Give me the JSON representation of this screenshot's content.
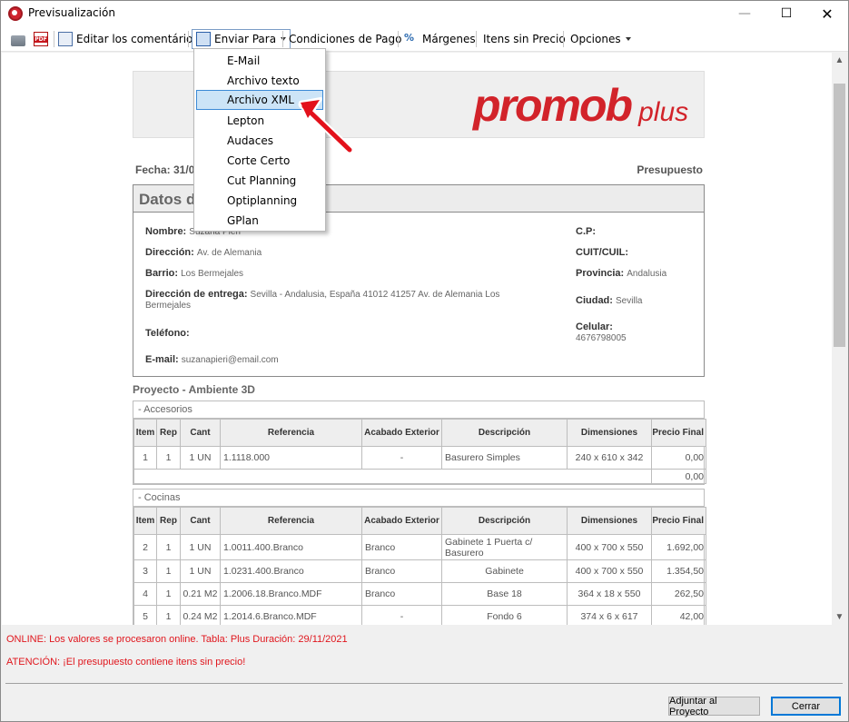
{
  "window": {
    "title": "Previsualización",
    "controls": {
      "minimize": "—",
      "maximize": "☐",
      "close": "✕"
    }
  },
  "toolbar": {
    "edit_comments": "Editar los comentários",
    "send_to": "Enviar Para",
    "payment_terms": "Condiciones de Pago",
    "margins": "Márgenes",
    "items_no_price": "Itens sin Precio",
    "options": "Opciones",
    "margins_icon_glyph": "%"
  },
  "send_menu": {
    "items": [
      "E-Mail",
      "Archivo texto",
      "Archivo XML",
      "Lepton",
      "Audaces",
      "Corte Certo",
      "Cut Planning",
      "Optiplanning",
      "GPlan"
    ],
    "highlighted": "Archivo XML"
  },
  "document": {
    "logo_main": "promob",
    "logo_sub": "plus",
    "date_label": "Fecha: 31/0",
    "doc_type": "Presupuesto",
    "client_section_title": "Datos de",
    "client": {
      "name_label": "Nombre:",
      "name_value": "Suzana Pieri",
      "address_label": "Dirección:",
      "address_value": "Av. de Alemania",
      "district_label": "Barrio:",
      "district_value": "Los Bermejales",
      "delivery_label": "Dirección de entrega:",
      "delivery_value": "Sevilla - Andalusia, España 41012 41257 Av. de Alemania Los Bermejales",
      "phone_label": "Teléfono:",
      "email_label": "E-mail:",
      "email_value": "suzanapieri@email.com",
      "zip_label": "C.P:",
      "tax_label": "CUIT/CUIL:",
      "province_label": "Provincia:",
      "province_value": "Andalusia",
      "city_label": "Ciudad:",
      "city_value": "Sevilla",
      "mobile_label": "Celular:",
      "mobile_value": "4676798005"
    },
    "project_title": "Proyecto - Ambiente 3D",
    "columns": [
      "Item",
      "Rep",
      "Cant",
      "Referencia",
      "Acabado Exterior",
      "Descripción",
      "Dimensiones",
      "Precio Final"
    ],
    "groups": [
      {
        "title": "- Accesorios",
        "rows": [
          [
            "1",
            "1",
            "1 UN",
            "1.1118.000",
            "-",
            "Basurero Simples",
            "240 x 610 x 342",
            "0,00"
          ]
        ],
        "subtotal": "0,00"
      },
      {
        "title": "- Cocinas",
        "rows": [
          [
            "2",
            "1",
            "1 UN",
            "1.0011.400.Branco",
            "Branco",
            "Gabinete 1 Puerta c/ Basurero",
            "400 x 700 x 550",
            "1.692,00"
          ],
          [
            "3",
            "1",
            "1 UN",
            "1.0231.400.Branco",
            "Branco",
            "Gabinete",
            "400 x 700 x 550",
            "1.354,50"
          ],
          [
            "4",
            "1",
            "0.21 M2",
            "1.2006.18.Branco.MDF",
            "Branco",
            "Base 18",
            "364 x 18 x 550",
            "262,50"
          ],
          [
            "5",
            "1",
            "0.24 M2",
            "1.2014.6.Branco.MDF",
            "-",
            "Fondo 6",
            "374 x 6 x 617",
            "42,00"
          ]
        ]
      }
    ]
  },
  "status": {
    "online": "ONLINE: Los valores se procesaron online. Tabla: Plus Duración: 29/11/2021",
    "warning": "ATENCIÓN: ¡El presupuesto contiene itens sin precio!"
  },
  "buttons": {
    "attach": "Adjuntar al Proyecto",
    "close": "Cerrar"
  },
  "scrollbar": {
    "up_glyph": "▲",
    "down_glyph": "▼"
  },
  "colors": {
    "brand_red": "#d2232a",
    "status_red": "#e0161d",
    "menu_highlight": "#cce4f7"
  }
}
